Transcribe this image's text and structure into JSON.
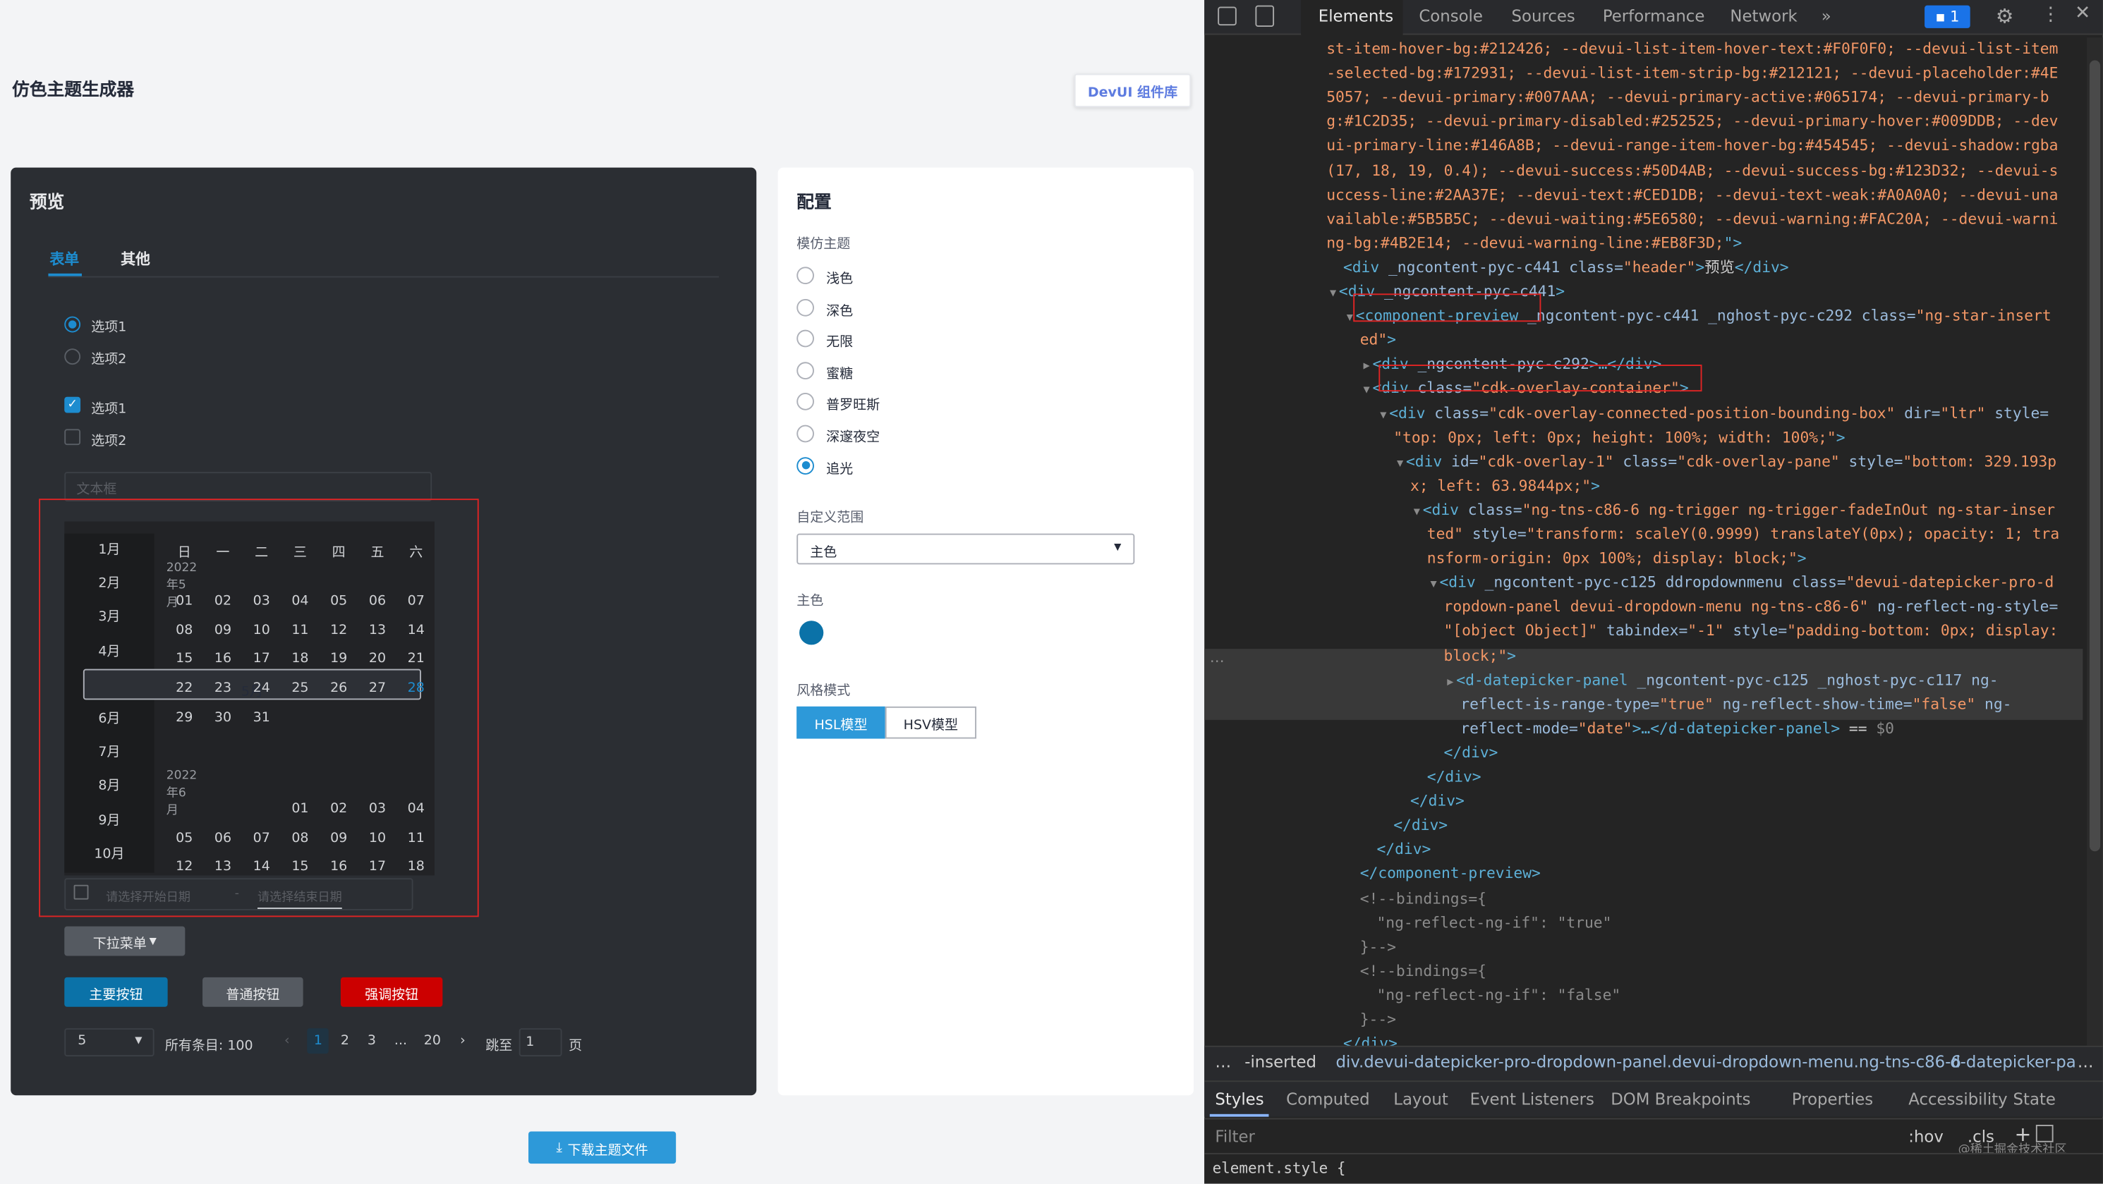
{
  "app": {
    "title": "仿色主题生成器",
    "devui_btn": "DevUI 组件库",
    "download": "下载主题文件"
  },
  "preview": {
    "header": "预览",
    "tabs": [
      "表单",
      "其他"
    ],
    "radios": [
      "选项1",
      "选项2"
    ],
    "checks": [
      "选项1",
      "选项2"
    ],
    "textbox_placeholder": "文本框",
    "months": [
      "1月",
      "2月",
      "3月",
      "4月",
      "5月",
      "6月",
      "7月",
      "8月",
      "9月",
      "10月"
    ],
    "weekdays": [
      "日",
      "一",
      "二",
      "三",
      "四",
      "五",
      "六"
    ],
    "cal1_caption": "2022年5月",
    "cal1_rows": [
      [
        "01",
        "02",
        "03",
        "04",
        "05",
        "06",
        "07"
      ],
      [
        "08",
        "09",
        "10",
        "11",
        "12",
        "13",
        "14"
      ],
      [
        "15",
        "16",
        "17",
        "18",
        "19",
        "20",
        "21"
      ],
      [
        "22",
        "23",
        "24",
        "25",
        "26",
        "27",
        "28"
      ],
      [
        "29",
        "30",
        "31",
        "",
        "",
        "",
        ""
      ]
    ],
    "cal2_caption": "2022年6月",
    "cal2_rows": [
      [
        "",
        "",
        "",
        "01",
        "02",
        "03",
        "04"
      ],
      [
        "05",
        "06",
        "07",
        "08",
        "09",
        "10",
        "11"
      ],
      [
        "12",
        "13",
        "14",
        "15",
        "16",
        "17",
        "18"
      ]
    ],
    "range_start": "请选择开始日期",
    "range_sep": "-",
    "range_end": "请选择结束日期",
    "dropdown": "下拉菜单",
    "btn_primary": "主要按钮",
    "btn_common": "普通按钮",
    "btn_danger": "强调按钮",
    "pager": {
      "size": "5",
      "total": "所有条目: 100",
      "pages": [
        "1",
        "2",
        "3",
        "...",
        "20"
      ],
      "jump": "跳至",
      "jump_value": "1",
      "page_unit": "页"
    }
  },
  "config": {
    "header": "配置",
    "theme_label": "模仿主题",
    "themes": [
      "浅色",
      "深色",
      "无限",
      "蜜糖",
      "普罗旺斯",
      "深邃夜空",
      "追光"
    ],
    "range_label": "自定义范围",
    "range_value": "主色",
    "color_label": "主色",
    "mode_label": "风格模式",
    "modes": [
      "HSL模型",
      "HSV模型"
    ]
  },
  "colors": {
    "primary": "#1d8ccf",
    "danger": "#cc0000",
    "swatch": "#0b72a8"
  },
  "devtools": {
    "tabs": [
      "Elements",
      "Console",
      "Sources",
      "Performance",
      "Network"
    ],
    "badge": "1",
    "lines": [
      {
        "i": 0,
        "p": [
          [
            "o",
            "st-item-hover-bg:#212426; --devui-list-item-hover-text:#F0F0F0; --devui-list-item"
          ]
        ]
      },
      {
        "i": 0,
        "p": [
          [
            "o",
            "-selected-bg:#172931; --devui-list-item-strip-bg:#212121; --devui-placeholder:#4E"
          ]
        ]
      },
      {
        "i": 0,
        "p": [
          [
            "o",
            "5057; --devui-primary:#007AAA; --devui-primary-active:#065174; --devui-primary-b"
          ]
        ]
      },
      {
        "i": 0,
        "p": [
          [
            "o",
            "g:#1C2D35; --devui-primary-disabled:#252525; --devui-primary-hover:#009DDB; --dev"
          ]
        ]
      },
      {
        "i": 0,
        "p": [
          [
            "o",
            "ui-primary-line:#146A8B; --devui-range-item-hover-bg:#454545; --devui-shadow:rgba"
          ]
        ]
      },
      {
        "i": 0,
        "p": [
          [
            "o",
            "(17, 18, 19, 0.4); --devui-success:#50D4AB; --devui-success-bg:#123D32; --devui-s"
          ]
        ]
      },
      {
        "i": 0,
        "p": [
          [
            "o",
            "uccess-line:#2AA37E; --devui-text:#CED1DB; --devui-text-weak:#A0A0A0; --devui-una"
          ]
        ]
      },
      {
        "i": 0,
        "p": [
          [
            "o",
            "vailable:#5B5B5C; --devui-waiting:#5E6580; --devui-warning:#FAC20A; --devui-warni"
          ]
        ]
      },
      {
        "i": 0,
        "p": [
          [
            "o",
            "ng-bg:#4B2E14; --devui-warning-line:#EB8F3D;"
          ],
          [
            "t",
            "\">"
          ]
        ]
      },
      {
        "i": 1,
        "p": [
          [
            "t",
            "<div "
          ],
          [
            "a",
            "_ngcontent-pyc-c441 class="
          ],
          [
            "v",
            "\"header\""
          ],
          [
            "t",
            ">"
          ],
          [
            "w",
            "预览"
          ],
          [
            "t",
            "</div>"
          ]
        ]
      },
      {
        "i": 1,
        "p": [
          [
            "g",
            "▼"
          ],
          [
            "t",
            "<div "
          ],
          [
            "a",
            "_ngcontent-pyc-c441"
          ],
          [
            "t",
            ">"
          ]
        ]
      },
      {
        "i": 2,
        "p": [
          [
            "g",
            "▼"
          ],
          [
            "t",
            "<component-preview"
          ],
          [
            "a",
            " _ngcontent-pyc-c441 _nghost-pyc-c292 class="
          ],
          [
            "v",
            "\"ng-star-insert"
          ]
        ]
      },
      {
        "i": 2,
        "p": [
          [
            "v",
            "ed\""
          ],
          [
            "t",
            ">"
          ]
        ]
      },
      {
        "i": 3,
        "p": [
          [
            "g",
            "▶"
          ],
          [
            "t",
            "<div "
          ],
          [
            "a",
            "_ngcontent-pyc-c292"
          ],
          [
            "t",
            ">…</div>"
          ]
        ]
      },
      {
        "i": 3,
        "p": [
          [
            "g",
            "▼"
          ],
          [
            "t",
            "<div "
          ],
          [
            "a",
            "class="
          ],
          [
            "v",
            "\"cdk-overlay-container\""
          ],
          [
            "t",
            ">"
          ]
        ]
      },
      {
        "i": 4,
        "p": [
          [
            "g",
            "▼"
          ],
          [
            "t",
            "<div "
          ],
          [
            "a",
            "class="
          ],
          [
            "v",
            "\"cdk-overlay-connected-position-bounding-box\""
          ],
          [
            "a",
            " dir="
          ],
          [
            "v",
            "\"ltr\""
          ],
          [
            "a",
            " style="
          ]
        ]
      },
      {
        "i": 4,
        "p": [
          [
            "v",
            "\"top: 0px; left: 0px; height: 100%; width: 100%;\""
          ],
          [
            "t",
            ">"
          ]
        ]
      },
      {
        "i": 5,
        "p": [
          [
            "g",
            "▼"
          ],
          [
            "t",
            "<div "
          ],
          [
            "a",
            "id="
          ],
          [
            "v",
            "\"cdk-overlay-1\""
          ],
          [
            "a",
            " class="
          ],
          [
            "v",
            "\"cdk-overlay-pane\""
          ],
          [
            "a",
            " style="
          ],
          [
            "v",
            "\"bottom: 329.193p"
          ]
        ]
      },
      {
        "i": 5,
        "p": [
          [
            "v",
            "x; left: 63.9844px;\""
          ],
          [
            "t",
            ">"
          ]
        ]
      },
      {
        "i": 6,
        "p": [
          [
            "g",
            "▼"
          ],
          [
            "t",
            "<div "
          ],
          [
            "a",
            "class="
          ],
          [
            "v",
            "\"ng-tns-c86-6 ng-trigger ng-trigger-fadeInOut ng-star-inser"
          ]
        ]
      },
      {
        "i": 6,
        "p": [
          [
            "v",
            "ted\""
          ],
          [
            "a",
            " style="
          ],
          [
            "v",
            "\"transform: scaleY(0.9999) translateY(0px); opacity: 1; tra"
          ]
        ]
      },
      {
        "i": 6,
        "p": [
          [
            "v",
            "nsform-origin: 0px 100%; display: block;\""
          ],
          [
            "t",
            ">"
          ]
        ]
      },
      {
        "i": 7,
        "p": [
          [
            "g",
            "▼"
          ],
          [
            "t",
            "<div "
          ],
          [
            "a",
            "_ngcontent-pyc-c125 ddropdownmenu class="
          ],
          [
            "v",
            "\"devui-datepicker-pro-d"
          ]
        ]
      },
      {
        "i": 7,
        "p": [
          [
            "v",
            "ropdown-panel devui-dropdown-menu ng-tns-c86-6\""
          ],
          [
            "a",
            " ng-reflect-ng-style="
          ]
        ]
      },
      {
        "i": 7,
        "p": [
          [
            "v",
            "\"[object Object]\""
          ],
          [
            "a",
            " tabindex="
          ],
          [
            "v",
            "\"-1\""
          ],
          [
            "a",
            " style="
          ],
          [
            "v",
            "\"padding-bottom: 0px; display:"
          ]
        ]
      },
      {
        "i": 7,
        "p": [
          [
            "v",
            "block;\""
          ],
          [
            "t",
            ">"
          ]
        ]
      },
      {
        "i": 8,
        "p": [
          [
            "g",
            "▶"
          ],
          [
            "t",
            "<d-datepicker-panel"
          ],
          [
            "a",
            " _ngcontent-pyc-c125 _nghost-pyc-c117 ng-"
          ]
        ]
      },
      {
        "i": 8,
        "p": [
          [
            "a",
            "reflect-is-range-type="
          ],
          [
            "v",
            "\"true\""
          ],
          [
            "a",
            " ng-reflect-show-time="
          ],
          [
            "v",
            "\"false\""
          ],
          [
            "a",
            " ng-"
          ]
        ]
      },
      {
        "i": 8,
        "p": [
          [
            "a",
            "reflect-mode="
          ],
          [
            "v",
            "\"date\""
          ],
          [
            "t",
            ">…</d-datepicker-panel>"
          ],
          [
            "w",
            " == "
          ],
          [
            "g",
            "$0"
          ]
        ]
      },
      {
        "i": 7,
        "p": [
          [
            "t",
            "</div>"
          ]
        ]
      },
      {
        "i": 6,
        "p": [
          [
            "t",
            "</div>"
          ]
        ]
      },
      {
        "i": 5,
        "p": [
          [
            "t",
            "</div>"
          ]
        ]
      },
      {
        "i": 4,
        "p": [
          [
            "t",
            "</div>"
          ]
        ]
      },
      {
        "i": 3,
        "p": [
          [
            "t",
            "</div>"
          ]
        ]
      },
      {
        "i": 2,
        "p": [
          [
            "t",
            "</component-preview>"
          ]
        ]
      },
      {
        "i": 2,
        "p": [
          [
            "g",
            "<!--bindings={"
          ]
        ]
      },
      {
        "i": 3,
        "p": [
          [
            "g",
            "\"ng-reflect-ng-if\": \"true\""
          ]
        ]
      },
      {
        "i": 2,
        "p": [
          [
            "g",
            "}-->"
          ]
        ]
      },
      {
        "i": 2,
        "p": [
          [
            "g",
            "<!--bindings={"
          ]
        ]
      },
      {
        "i": 3,
        "p": [
          [
            "g",
            "\"ng-reflect-ng-if\": \"false\""
          ]
        ]
      },
      {
        "i": 2,
        "p": [
          [
            "g",
            "}-->"
          ]
        ]
      },
      {
        "i": 1,
        "p": [
          [
            "t",
            "</div>"
          ]
        ]
      },
      {
        "i": 0,
        "p": [
          [
            "t",
            "</div>"
          ]
        ]
      }
    ],
    "breadcrumb": [
      "…",
      "-inserted",
      "div.devui-datepicker-pro-dropdown-panel.devui-dropdown-menu.ng-tns-c86-6",
      "d-datepicker-pa",
      "…"
    ],
    "style_tabs": [
      "Styles",
      "Computed",
      "Layout",
      "Event Listeners",
      "DOM Breakpoints",
      "Properties",
      "Accessibility",
      "State"
    ],
    "filter": "Filter",
    "hov": ":hov",
    "cls": ".cls",
    "watermark": "@稀土掘金技术社区",
    "bottom_line": "element.style {"
  }
}
